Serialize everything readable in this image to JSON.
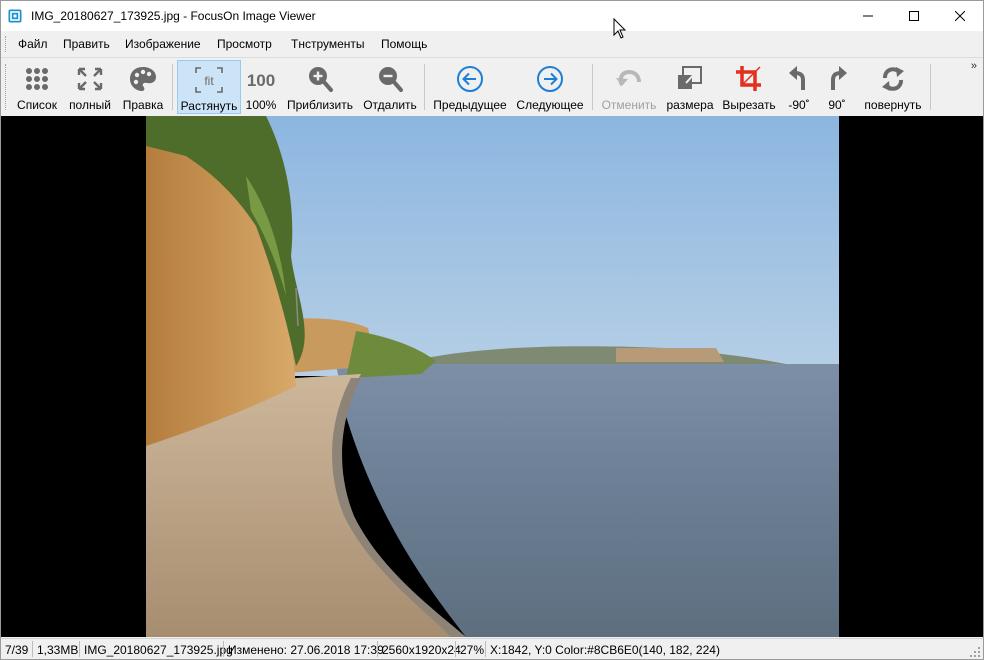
{
  "window": {
    "title": "IMG_20180627_173925.jpg - FocusOn Image Viewer",
    "icon": "app-icon"
  },
  "menu": {
    "items": [
      "Файл",
      "Править",
      "Изображение",
      "Просмотр",
      "Тнструменты",
      "Помощь"
    ]
  },
  "toolbar": {
    "buttons": [
      {
        "label": "Список",
        "icon": "grid-icon"
      },
      {
        "label": "полный",
        "icon": "fullscreen-icon"
      },
      {
        "label": "Правка",
        "icon": "palette-icon"
      },
      {
        "label": "Растянуть",
        "icon": "fit-icon",
        "badge": "fit",
        "active": true
      },
      {
        "label": "100%",
        "icon": "actual-size-icon",
        "badge": "100"
      },
      {
        "label": "Приблизить",
        "icon": "zoom-in-icon"
      },
      {
        "label": "Отдалить",
        "icon": "zoom-out-icon"
      },
      {
        "label": "Предыдущее",
        "icon": "arrow-left-icon"
      },
      {
        "label": "Следующее",
        "icon": "arrow-right-icon"
      },
      {
        "label": "Отменить",
        "icon": "undo-icon",
        "disabled": true
      },
      {
        "label": "размера",
        "icon": "resize-icon"
      },
      {
        "label": "Вырезать",
        "icon": "crop-icon"
      },
      {
        "label": "-90˚",
        "icon": "rotate-left-icon"
      },
      {
        "label": "90˚",
        "icon": "rotate-right-icon"
      },
      {
        "label": "повернуть",
        "icon": "rotate-icon"
      }
    ],
    "more": "»"
  },
  "status": {
    "index": "7/39",
    "filesize": "1,33MB",
    "filename": "IMG_20180627_173925.jpg",
    "modified": "Изменено: 27.06.2018 17:39",
    "dimensions": "2560x1920x24",
    "zoom": "27%",
    "pixel": "X:1842, Y:0 Color:#8CB6E0(140, 182, 224)"
  },
  "colors": {
    "accent": "#1e7fd6",
    "crop": "#e0301e",
    "sky": "#8CB6E0"
  }
}
